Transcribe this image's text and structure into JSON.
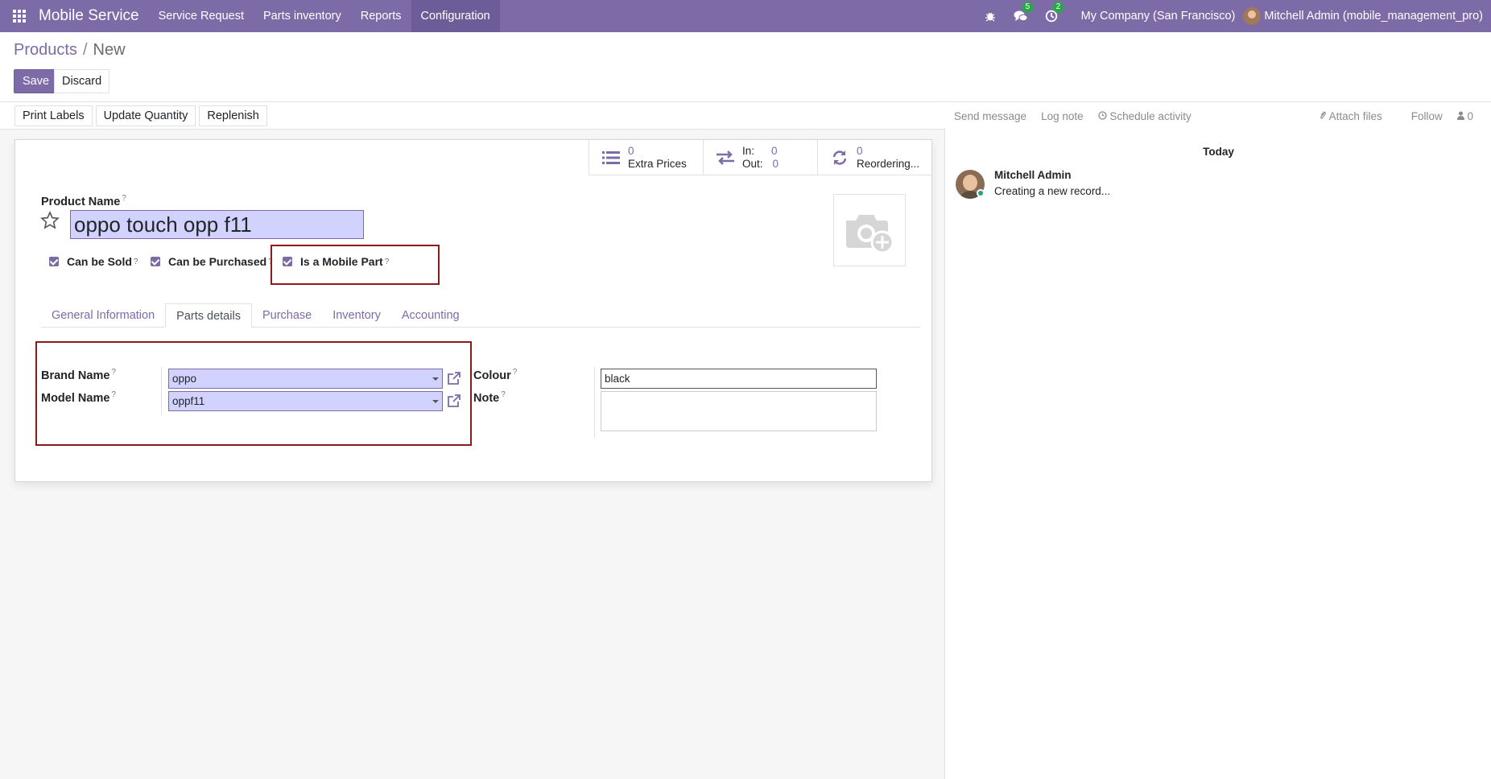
{
  "navbar": {
    "app_name": "Mobile Service",
    "menu": [
      {
        "label": "Service Request"
      },
      {
        "label": "Parts inventory"
      },
      {
        "label": "Reports"
      },
      {
        "label": "Configuration"
      }
    ],
    "messages_count": "5",
    "activities_count": "2",
    "company": "My Company (San Francisco)",
    "user": "Mitchell Admin (mobile_management_pro)"
  },
  "breadcrumb": {
    "parent": "Products",
    "sep": "/",
    "current": "New"
  },
  "actions": {
    "save": "Save",
    "discard": "Discard"
  },
  "statusbar": {
    "buttons": [
      "Print Labels",
      "Update Quantity",
      "Replenish"
    ]
  },
  "smart_buttons": {
    "extra_prices": {
      "value": "0",
      "label": "Extra Prices"
    },
    "in_out": {
      "in_label": "In:",
      "in_value": "0",
      "out_label": "Out:",
      "out_value": "0"
    },
    "reordering": {
      "value": "0",
      "label": "Reordering..."
    }
  },
  "form": {
    "product_name_label": "Product Name",
    "product_name": "oppo touch opp f11",
    "help": "?",
    "checkboxes": {
      "can_be_sold": "Can be Sold",
      "can_be_purchased": "Can be Purchased",
      "is_mobile_part": "Is a Mobile Part"
    },
    "tabs": [
      "General Information",
      "Parts details",
      "Purchase",
      "Inventory",
      "Accounting"
    ],
    "active_tab": "Parts details",
    "brand_name_label": "Brand Name",
    "brand_name": "oppo",
    "model_name_label": "Model Name",
    "model_name": "oppf11",
    "colour_label": "Colour",
    "colour": "black",
    "note_label": "Note",
    "note": ""
  },
  "chatter": {
    "send_message": "Send message",
    "log_note": "Log note",
    "schedule_activity": "Schedule activity",
    "attach_files": "Attach files",
    "follow": "Follow",
    "followers": "0",
    "today": "Today",
    "author": "Mitchell Admin",
    "message": "Creating a new record..."
  },
  "colors": {
    "primary": "#7c6ba6",
    "input_bg": "#d2d2ff",
    "highlight_box": "#8b1a1a",
    "badge": "#28a745"
  }
}
